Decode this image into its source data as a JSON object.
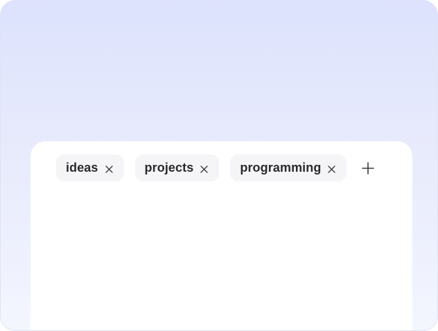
{
  "tags": [
    {
      "label": "ideas",
      "remove_icon": "close-icon"
    },
    {
      "label": "projects",
      "remove_icon": "close-icon"
    },
    {
      "label": "programming",
      "remove_icon": "close-icon"
    }
  ],
  "add_button": {
    "icon": "plus-icon"
  },
  "colors": {
    "background_top": "#dde2fd",
    "background_bottom": "#f4f6fe",
    "card": "#ffffff",
    "tag_background": "#f5f5f7",
    "tag_text": "#2a2a2e",
    "icon": "#3a3a3e"
  }
}
